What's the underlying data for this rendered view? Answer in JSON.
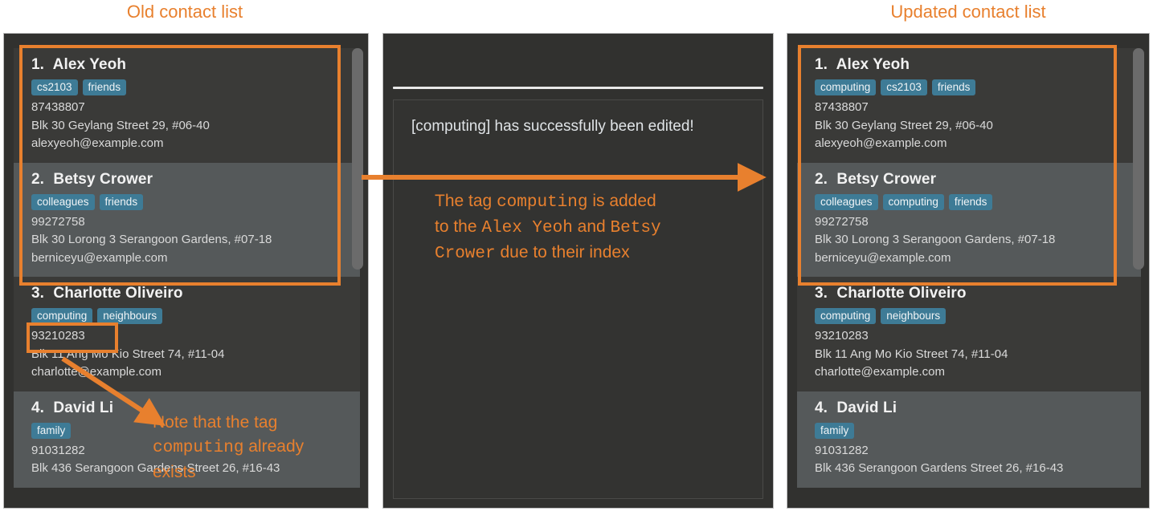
{
  "captions": {
    "left": "Old contact list",
    "right": "Updated contact list"
  },
  "colors": {
    "accent": "#E8802E",
    "tag": "#3E7B96",
    "panel_bg": "#31312F",
    "card_odd": "#3A3A38",
    "card_even": "#55595A"
  },
  "old_list": {
    "contacts": [
      {
        "index": "1.",
        "name": "Alex Yeoh",
        "tags": [
          "cs2103",
          "friends"
        ],
        "phone": "87438807",
        "address": "Blk 30 Geylang Street 29, #06-40",
        "email": "alexyeoh@example.com"
      },
      {
        "index": "2.",
        "name": "Betsy Crower",
        "tags": [
          "colleagues",
          "friends"
        ],
        "phone": "99272758",
        "address": "Blk 30 Lorong 3 Serangoon Gardens, #07-18",
        "email": "berniceyu@example.com"
      },
      {
        "index": "3.",
        "name": "Charlotte Oliveiro",
        "tags": [
          "computing",
          "neighbours"
        ],
        "phone": "93210283",
        "address": "Blk 11 Ang Mo Kio Street 74, #11-04",
        "email": "charlotte@example.com"
      },
      {
        "index": "4.",
        "name": "David Li",
        "tags": [
          "family"
        ],
        "phone": "91031282",
        "address": "Blk 436 Serangoon Gardens Street 26, #16-43",
        "email": ""
      }
    ]
  },
  "updated_list": {
    "contacts": [
      {
        "index": "1.",
        "name": "Alex Yeoh",
        "tags": [
          "computing",
          "cs2103",
          "friends"
        ],
        "phone": "87438807",
        "address": "Blk 30 Geylang Street 29, #06-40",
        "email": "alexyeoh@example.com"
      },
      {
        "index": "2.",
        "name": "Betsy Crower",
        "tags": [
          "colleagues",
          "computing",
          "friends"
        ],
        "phone": "99272758",
        "address": "Blk 30 Lorong 3 Serangoon Gardens, #07-18",
        "email": "berniceyu@example.com"
      },
      {
        "index": "3.",
        "name": "Charlotte Oliveiro",
        "tags": [
          "computing",
          "neighbours"
        ],
        "phone": "93210283",
        "address": "Blk 11 Ang Mo Kio Street 74, #11-04",
        "email": "charlotte@example.com"
      },
      {
        "index": "4.",
        "name": "David Li",
        "tags": [
          "family"
        ],
        "phone": "91031282",
        "address": "Blk 436 Serangoon Gardens Street 26, #16-43",
        "email": ""
      }
    ]
  },
  "middle_panel": {
    "result_message": "[computing] has successfully been edited!"
  },
  "annotations": {
    "middle": {
      "line1_a": "The tag ",
      "line1_mono": "computing",
      "line1_b": " is added",
      "line2_a": "to the ",
      "line2_mono": "Alex Yeoh",
      "line2_b": " and ",
      "line2_mono2": "Betsy",
      "line3_mono": "Crower",
      "line3_b": " due to their index"
    },
    "left": {
      "line1": "Note that the tag",
      "mono": "computing",
      "line2_b": " already",
      "line3": "exists"
    }
  }
}
